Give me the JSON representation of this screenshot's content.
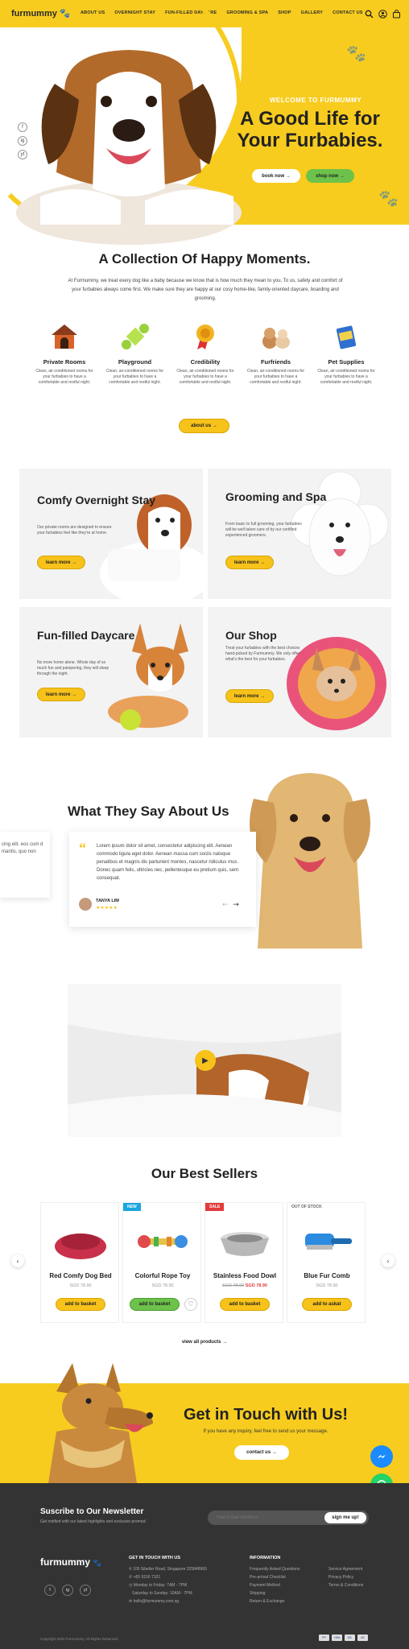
{
  "header": {
    "logo": "furmummy",
    "nav": [
      "ABOUT US",
      "OVERNIGHT STAY",
      "FUN-FILLED DAYCARE",
      "GROOMING & SPA",
      "SHOP",
      "GALLERY",
      "CONTACT US"
    ],
    "icons": [
      "search-icon",
      "user-icon",
      "cart-icon"
    ]
  },
  "hero": {
    "welcome": "WELCOME TO FURMUMMY",
    "title": "A Good Life for Your Furbabies.",
    "book_label": "book now",
    "shop_label": "shop now",
    "socials": [
      "f",
      "ig",
      "yt"
    ],
    "slide_count": 4
  },
  "moments": {
    "title": "A Collection Of Happy Moments.",
    "intro": "At Furmummy, we treat every dog like a baby because we know that is how much they mean to you. To us, safety and comfort of your furbabies always come first. We make sure they are happy at our cosy home-like, family-oriented daycare, boarding and grooming.",
    "features": [
      {
        "title": "Private Rooms",
        "desc": "Clean, air-conditioned rooms for your furbabies to have a comfortable and restful night."
      },
      {
        "title": "Playground",
        "desc": "Clean, air-conditioned rooms for your furbabies to have a comfortable and restful night."
      },
      {
        "title": "Credibility",
        "desc": "Clean, air-conditioned rooms for your furbabies to have a comfortable and restful night."
      },
      {
        "title": "Furfriends",
        "desc": "Clean, air-conditioned rooms for your furbabies to have a comfortable and restful night."
      },
      {
        "title": "Pet Supplies",
        "desc": "Clean, air-conditioned rooms for your furbabies to have a comfortable and restful night."
      }
    ],
    "about_label": "about us"
  },
  "services": [
    {
      "title": "Comfy Overnight Stay",
      "desc": "Our private rooms are designed to ensure your furbabies feel like they're at home.",
      "btn": "learn more"
    },
    {
      "title": "Grooming and Spa",
      "desc": "From basic to full grooming, your furbabies will be well taken care of by our certified experienced groomers.",
      "btn": "learn more"
    },
    {
      "title": "Fun-filled Daycare",
      "desc": "No more home alone. Whole day of so much fun and pampering, they will sleep through the night.",
      "btn": "learn more"
    },
    {
      "title": "Our Shop",
      "desc": "Treat your furbabies with the best choices hand-picked by Furmummy. We only offer what's the best for your furbabies.",
      "btn": "learn more"
    }
  ],
  "testimonials": {
    "title": "What They Say About Us",
    "partial_text": "cing elit. eos cum d mantis, quo non",
    "text": "Lorem ipsum dolor sit amet, consectetur adipiscing elit. Aenean commodo ligula eget dolor. Aenean massa cum sociis natoque penatibus et magnis dis parturient montes, nascetur ridiculus mus. Donec quam felis, ultricies nec, pellentesque eu pretium quis, sem consequat.",
    "name": "TANYA LIM",
    "stars": "★★★★★",
    "prev": "←",
    "next": "→"
  },
  "video": {
    "play": "▶"
  },
  "bestsellers": {
    "title": "Our Best Sellers",
    "products": [
      {
        "name": "Red Comfy Dog Bed",
        "old_price": "SGD 78.90",
        "price": "",
        "btn": "add to basket",
        "badge": "",
        "badge_color": ""
      },
      {
        "name": "Colorful Rope Toy",
        "old_price": "SGD 78.90",
        "price": "",
        "btn": "add to basket",
        "badge": "NEW",
        "badge_color": "#1aa6e0"
      },
      {
        "name": "Stainless Food Dowl",
        "old_price": "SGD 78.90",
        "price": "SGD 78.90",
        "btn": "add to basket",
        "badge": "SALE",
        "badge_color": "#e23b3b"
      },
      {
        "name": "Blue Fur Comb",
        "old_price": "SGD 78.90",
        "price": "",
        "btn": "add to askat",
        "badge": "OUT OF STOCK",
        "badge_color": ""
      }
    ],
    "view_all": "view all products"
  },
  "contact": {
    "title": "Get in Touch with Us!",
    "sub": "If you have any inquiry, feel free to send us your message.",
    "btn": "contact us"
  },
  "footer": {
    "nl_title": "Suscribe to Our Newsletter",
    "nl_sub": "Get notified with our latest highlights and exclusive promos!",
    "email_placeholder": "Your Email Address",
    "signup": "sign me up!",
    "logo": "furmummy",
    "socials": [
      "f",
      "ig",
      "yt"
    ],
    "touch_title": "GET IN TOUCH WITH US",
    "touch": [
      "105 Sibeller Road, Singapore 325848960",
      "+65 9150 7101",
      "Monday to Friday: 7AM - 7PM",
      "Saturday to Sunday: 10AM - 7PM",
      "hello@furmummy.com.sg"
    ],
    "info_title": "INFORMATION",
    "info1": [
      "Frequently Asked Questions",
      "Pre-arrival Checklist",
      "Payment Method",
      "Shipping",
      "Return & Exchange"
    ],
    "info2": [
      "Service Agreement",
      "Privacy Policy",
      "Terms & Conditions"
    ],
    "copyright": "Copyright 2020 Furmummy. All Rights Reserved.",
    "payments": [
      "PP",
      "VISA",
      "MC",
      "AE"
    ]
  },
  "colors": {
    "brand_yellow": "#f7cc1f",
    "green": "#6cc24a",
    "footer": "#333333"
  }
}
